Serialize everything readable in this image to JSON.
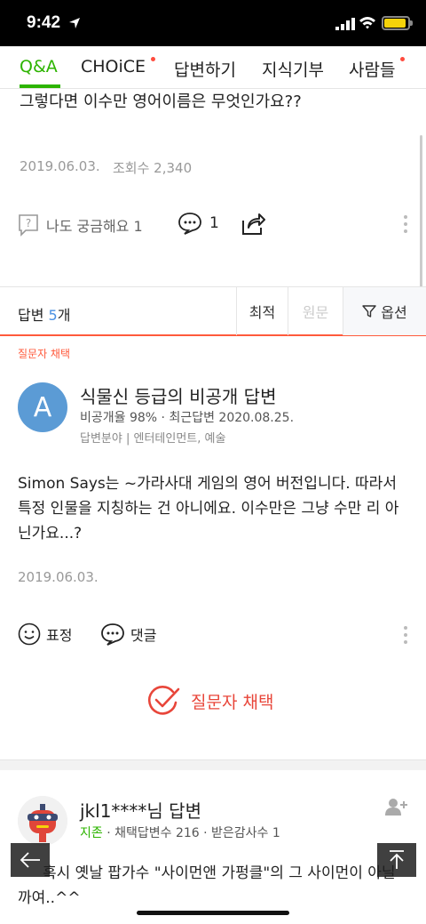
{
  "status": {
    "time": "9:42"
  },
  "tabs": [
    {
      "label": "Q&A",
      "active": true
    },
    {
      "label": "CHOiCE",
      "dot": true
    },
    {
      "label": "답변하기"
    },
    {
      "label": "지식기부"
    },
    {
      "label": "사람들",
      "dot": true
    }
  ],
  "question": {
    "text": "그렇다면 이수만 영어이름은 무엇인가요??",
    "date": "2019.06.03.",
    "views": "조회수 2,340",
    "curious": "나도 궁금해요 1",
    "comments": "1"
  },
  "sort": {
    "answers_prefix": "답변 ",
    "answers_count": "5",
    "answers_suffix": "개",
    "options": [
      "최적",
      "원문"
    ],
    "filter_label": "옵션"
  },
  "answer1": {
    "chosen_label": "질문자 채택",
    "avatar_letter": "A",
    "name": "식물신 등급의 비공개 답변",
    "stats": "비공개율 98%  ·  최근답변 2020.08.25.",
    "field": "답변분야 | 엔터테인먼트, 예술",
    "body": "Simon Says는 ~가라사대 게임의 영어 버전입니다. 따라서 특정 인물을 지칭하는 건 아니에요. 이수만은 그냥 수만 리 아닌가요...?",
    "date": "2019.06.03.",
    "reaction_label": "표정",
    "comment_label": "댓글",
    "choose_label": "질문자 채택"
  },
  "answer2": {
    "name": "jkl1****님 답변",
    "level": "지존",
    "stats": " · 채택답변수 216 · 받은감사수 1",
    "body": "혹시 옛날 팝가수 \"사이먼앤 가펑클\"의 그 사이먼이 아닐까여..^^"
  },
  "colors": {
    "accent_green": "#2db400",
    "accent_red": "#ff5a3c"
  }
}
